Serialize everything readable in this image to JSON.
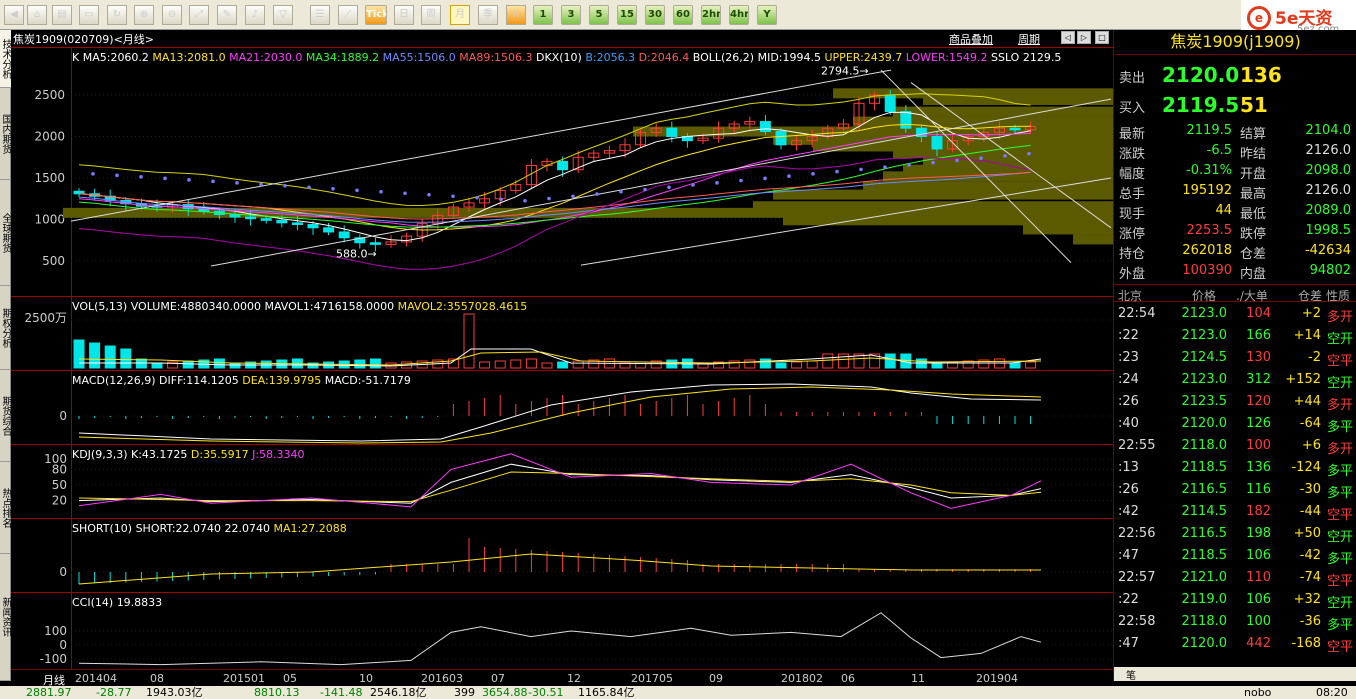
{
  "toolbar": {
    "icons": [
      "home-icon",
      "folder-icon",
      "screen-icon",
      "refresh-icon",
      "zoom-in-icon",
      "zoom-out-icon",
      "fullscreen-icon",
      "pen-icon",
      "bell-icon",
      "funnel-icon",
      "table-icon",
      "line-chart-icon"
    ],
    "period_buttons": [
      "Tick",
      "日",
      "周",
      "月",
      "季",
      "X",
      "1",
      "3",
      "5",
      "15",
      "30",
      "60",
      "2hr",
      "4hr",
      "Y"
    ],
    "active_period": "月"
  },
  "brand": {
    "name": "5e天资",
    "sub": "5ez.com"
  },
  "left_tabs": [
    "技术分析",
    "国内期货",
    "全球期货",
    "期权分析",
    "期货综合",
    "热点排名",
    "新闻资讯"
  ],
  "chart": {
    "title": "焦炭1909(020709)<月线>",
    "links": [
      "商品叠加",
      "周期"
    ],
    "main_label": "K",
    "ma": [
      {
        "text": "MA5:2060.2",
        "color": "#ffffff"
      },
      {
        "text": "MA13:2081.0",
        "color": "#ffe31a"
      },
      {
        "text": "MA21:2030.0",
        "color": "#ff3bff"
      },
      {
        "text": "MA34:1889.2",
        "color": "#2bff2b"
      },
      {
        "text": "MA55:1506.0",
        "color": "#6a8cff"
      },
      {
        "text": "MA89:1506.3",
        "color": "#ff5a5a"
      },
      {
        "text": "DKX(10)",
        "color": "#ffffff"
      },
      {
        "text": "B:2056.3",
        "color": "#3aa0ff"
      },
      {
        "text": "D:2046.4",
        "color": "#ff5a5a"
      },
      {
        "text": "BOLL(26,2)",
        "color": "#ffffff"
      },
      {
        "text": "MID:1994.5",
        "color": "#ffffff"
      },
      {
        "text": "UPPER:2439.7",
        "color": "#ffe31a"
      },
      {
        "text": "LOWER:1549.2",
        "color": "#ff3bff"
      },
      {
        "text": "SSLO 2129.5",
        "color": "#ffffff"
      }
    ],
    "y_ticks": [
      "2500",
      "2000",
      "1500",
      "1000",
      "500"
    ],
    "high_marker": "2794.5",
    "low_marker": "588.0",
    "vol_label": "VOL(5,13)",
    "vol_values": [
      {
        "text": "VOLUME:4880340.0000",
        "color": "#ffffff"
      },
      {
        "text": "MAVOL1:4716158.0000",
        "color": "#ffffff"
      },
      {
        "text": "MAVOL2:3557028.4615",
        "color": "#ffe31a"
      }
    ],
    "vol_tick": "2500万",
    "macd_label": "MACD(12,26,9)",
    "macd_values": [
      {
        "text": "DIFF:114.1205",
        "color": "#ffffff"
      },
      {
        "text": "DEA:139.9795",
        "color": "#ffe31a"
      },
      {
        "text": "MACD:-51.7179",
        "color": "#ffffff"
      }
    ],
    "macd_tick": "0",
    "kdj_label": "KDJ(9,3,3)",
    "kdj_values": [
      {
        "text": "K:43.1725",
        "color": "#ffffff"
      },
      {
        "text": "D:35.5917",
        "color": "#ffe31a"
      },
      {
        "text": "J:58.3340",
        "color": "#ff3bff"
      }
    ],
    "kdj_ticks": [
      "100",
      "80",
      "50",
      "20"
    ],
    "short_label": "SHORT(10)",
    "short_values": [
      {
        "text": "SHORT:22.0740",
        "color": "#ffffff"
      },
      {
        "text": "22.0740",
        "color": "#ffffff"
      },
      {
        "text": "MA1:27.2088",
        "color": "#ffe31a"
      }
    ],
    "short_tick": "0",
    "cci_label": "CCI(14)",
    "cci_values": [
      {
        "text": "19.8833",
        "color": "#ffffff"
      }
    ],
    "cci_ticks": [
      "100",
      "0",
      "-100"
    ],
    "x_axis_label": "月线",
    "x_labels": [
      "201404",
      "08",
      "201501",
      "05",
      "10",
      "201603",
      "07",
      "12",
      "201705",
      "09",
      "201802",
      "06",
      "11",
      "201904"
    ]
  },
  "chart_data": {
    "type": "candlestick",
    "period": "monthly",
    "categories": [
      "201404",
      "08",
      "201501",
      "05",
      "10",
      "201603",
      "07",
      "12",
      "201705",
      "09",
      "201802",
      "06",
      "11",
      "201904"
    ],
    "close_approx": [
      1310,
      1190,
      1150,
      1030,
      900,
      720,
      1200,
      1650,
      1800,
      2050,
      2000,
      2400,
      2000,
      2120
    ],
    "high": 2794.5,
    "low": 588.0
  },
  "quote": {
    "title": "焦炭1909(j1909)",
    "sell_label": "卖出",
    "sell_price": "2120.0",
    "sell_vol": "136",
    "buy_label": "买入",
    "buy_price": "2119.5",
    "buy_vol": "51",
    "rows": [
      {
        "l1": "最新",
        "v1": "2119.5",
        "c1": "dn",
        "l2": "结算",
        "v2": "2104.0",
        "c2": "dn"
      },
      {
        "l1": "涨跌",
        "v1": "-6.5",
        "c1": "dn",
        "l2": "昨结",
        "v2": "2126.0",
        "c2": "wh"
      },
      {
        "l1": "幅度",
        "v1": "-0.31%",
        "c1": "dn",
        "l2": "开盘",
        "v2": "2098.0",
        "c2": "dn"
      },
      {
        "l1": "总手",
        "v1": "195192",
        "c1": "yl",
        "l2": "最高",
        "v2": "2126.0",
        "c2": "wh"
      },
      {
        "l1": "现手",
        "v1": "44",
        "c1": "yl",
        "l2": "最低",
        "v2": "2089.0",
        "c2": "dn"
      },
      {
        "l1": "涨停",
        "v1": "2253.5",
        "c1": "up",
        "l2": "跌停",
        "v2": "1998.5",
        "c2": "dn"
      },
      {
        "l1": "持仓",
        "v1": "262018",
        "c1": "yl",
        "l2": "仓差",
        "v2": "-42634",
        "c2": "yl"
      },
      {
        "l1": "外盘",
        "v1": "100390",
        "c1": "up",
        "l2": "内盘",
        "v2": "94802",
        "c2": "dn"
      }
    ],
    "tick_headers": [
      "北京",
      "价格",
      "./大单",
      "仓差",
      "性质"
    ],
    "ticks": [
      {
        "t": "22:54",
        "p": "2123.0",
        "pc": "dn",
        "v": "104",
        "vc": "up",
        "o": "+2",
        "oc": "yl",
        "k": "多开",
        "kc": "up"
      },
      {
        "t": ":22",
        "p": "2123.0",
        "pc": "dn",
        "v": "166",
        "vc": "dn",
        "o": "+14",
        "oc": "yl",
        "k": "空开",
        "kc": "dn"
      },
      {
        "t": ":23",
        "p": "2124.5",
        "pc": "dn",
        "v": "130",
        "vc": "up",
        "o": "-2",
        "oc": "yl",
        "k": "空平",
        "kc": "up"
      },
      {
        "t": ":24",
        "p": "2123.0",
        "pc": "dn",
        "v": "312",
        "vc": "dn",
        "o": "+152",
        "oc": "yl",
        "k": "空开",
        "kc": "dn"
      },
      {
        "t": ":26",
        "p": "2123.5",
        "pc": "dn",
        "v": "120",
        "vc": "up",
        "o": "+44",
        "oc": "yl",
        "k": "多开",
        "kc": "up"
      },
      {
        "t": ":40",
        "p": "2120.0",
        "pc": "dn",
        "v": "126",
        "vc": "dn",
        "o": "-64",
        "oc": "yl",
        "k": "多平",
        "kc": "dn"
      },
      {
        "t": "22:55",
        "p": "2118.0",
        "pc": "dn",
        "v": "100",
        "vc": "up",
        "o": "+6",
        "oc": "yl",
        "k": "多开",
        "kc": "up"
      },
      {
        "t": ":13",
        "p": "2118.5",
        "pc": "dn",
        "v": "136",
        "vc": "dn",
        "o": "-124",
        "oc": "yl",
        "k": "多平",
        "kc": "dn"
      },
      {
        "t": ":26",
        "p": "2116.5",
        "pc": "dn",
        "v": "116",
        "vc": "dn",
        "o": "-30",
        "oc": "yl",
        "k": "多平",
        "kc": "dn"
      },
      {
        "t": ":42",
        "p": "2114.5",
        "pc": "dn",
        "v": "182",
        "vc": "up",
        "o": "-44",
        "oc": "yl",
        "k": "空平",
        "kc": "up"
      },
      {
        "t": "22:56",
        "p": "2116.5",
        "pc": "dn",
        "v": "198",
        "vc": "dn",
        "o": "+50",
        "oc": "yl",
        "k": "空开",
        "kc": "dn"
      },
      {
        "t": ":47",
        "p": "2118.5",
        "pc": "dn",
        "v": "106",
        "vc": "dn",
        "o": "-42",
        "oc": "yl",
        "k": "多平",
        "kc": "dn"
      },
      {
        "t": "22:57",
        "p": "2121.0",
        "pc": "dn",
        "v": "110",
        "vc": "up",
        "o": "-74",
        "oc": "yl",
        "k": "空平",
        "kc": "up"
      },
      {
        "t": ":22",
        "p": "2119.0",
        "pc": "dn",
        "v": "106",
        "vc": "dn",
        "o": "+32",
        "oc": "yl",
        "k": "空开",
        "kc": "dn"
      },
      {
        "t": "22:58",
        "p": "2118.0",
        "pc": "dn",
        "v": "100",
        "vc": "dn",
        "o": "-36",
        "oc": "yl",
        "k": "多平",
        "kc": "dn"
      },
      {
        "t": ":47",
        "p": "2120.0",
        "pc": "dn",
        "v": "442",
        "vc": "up",
        "o": "-168",
        "oc": "yl",
        "k": "空平",
        "kc": "up"
      }
    ],
    "footer": "笔"
  },
  "status": {
    "items": [
      "2881.97",
      "-28.77",
      "1943.03亿",
      "8810.13",
      "-141.48",
      "2546.18亿",
      "399",
      "3654.88",
      "-30.51",
      "1165.84亿"
    ],
    "right_items": [
      "nobo",
      "08:20"
    ]
  }
}
